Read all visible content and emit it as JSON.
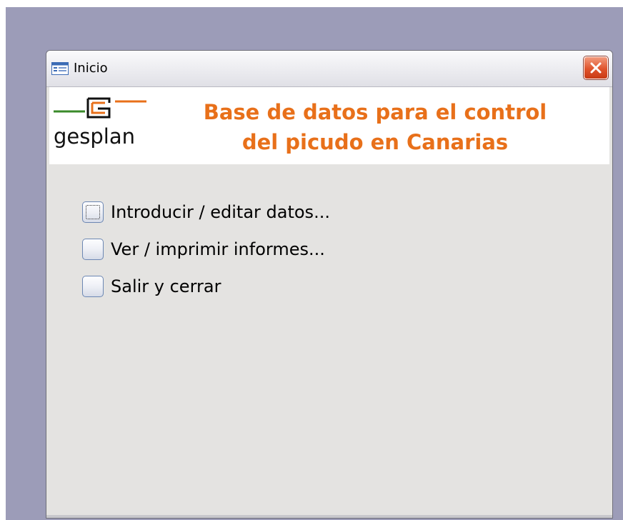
{
  "window": {
    "title": "Inicio",
    "title_icon": "form-icon",
    "close_icon": "close-icon"
  },
  "header": {
    "logo_text": "gesplan",
    "logo_icon": "gesplan-logo-icon",
    "title_line1": "Base de datos para el control",
    "title_line2": "del picudo en Canarias"
  },
  "menu": {
    "items": [
      {
        "label": "Introducir / editar datos...",
        "focused": true
      },
      {
        "label": "Ver / imprimir informes...",
        "focused": false
      },
      {
        "label": "Salir y cerrar",
        "focused": false
      }
    ]
  },
  "colors": {
    "desktop": "#9c9cb8",
    "header_title": "#e8701a",
    "logo_orange": "#e8701a",
    "logo_green": "#3a8a2a"
  }
}
